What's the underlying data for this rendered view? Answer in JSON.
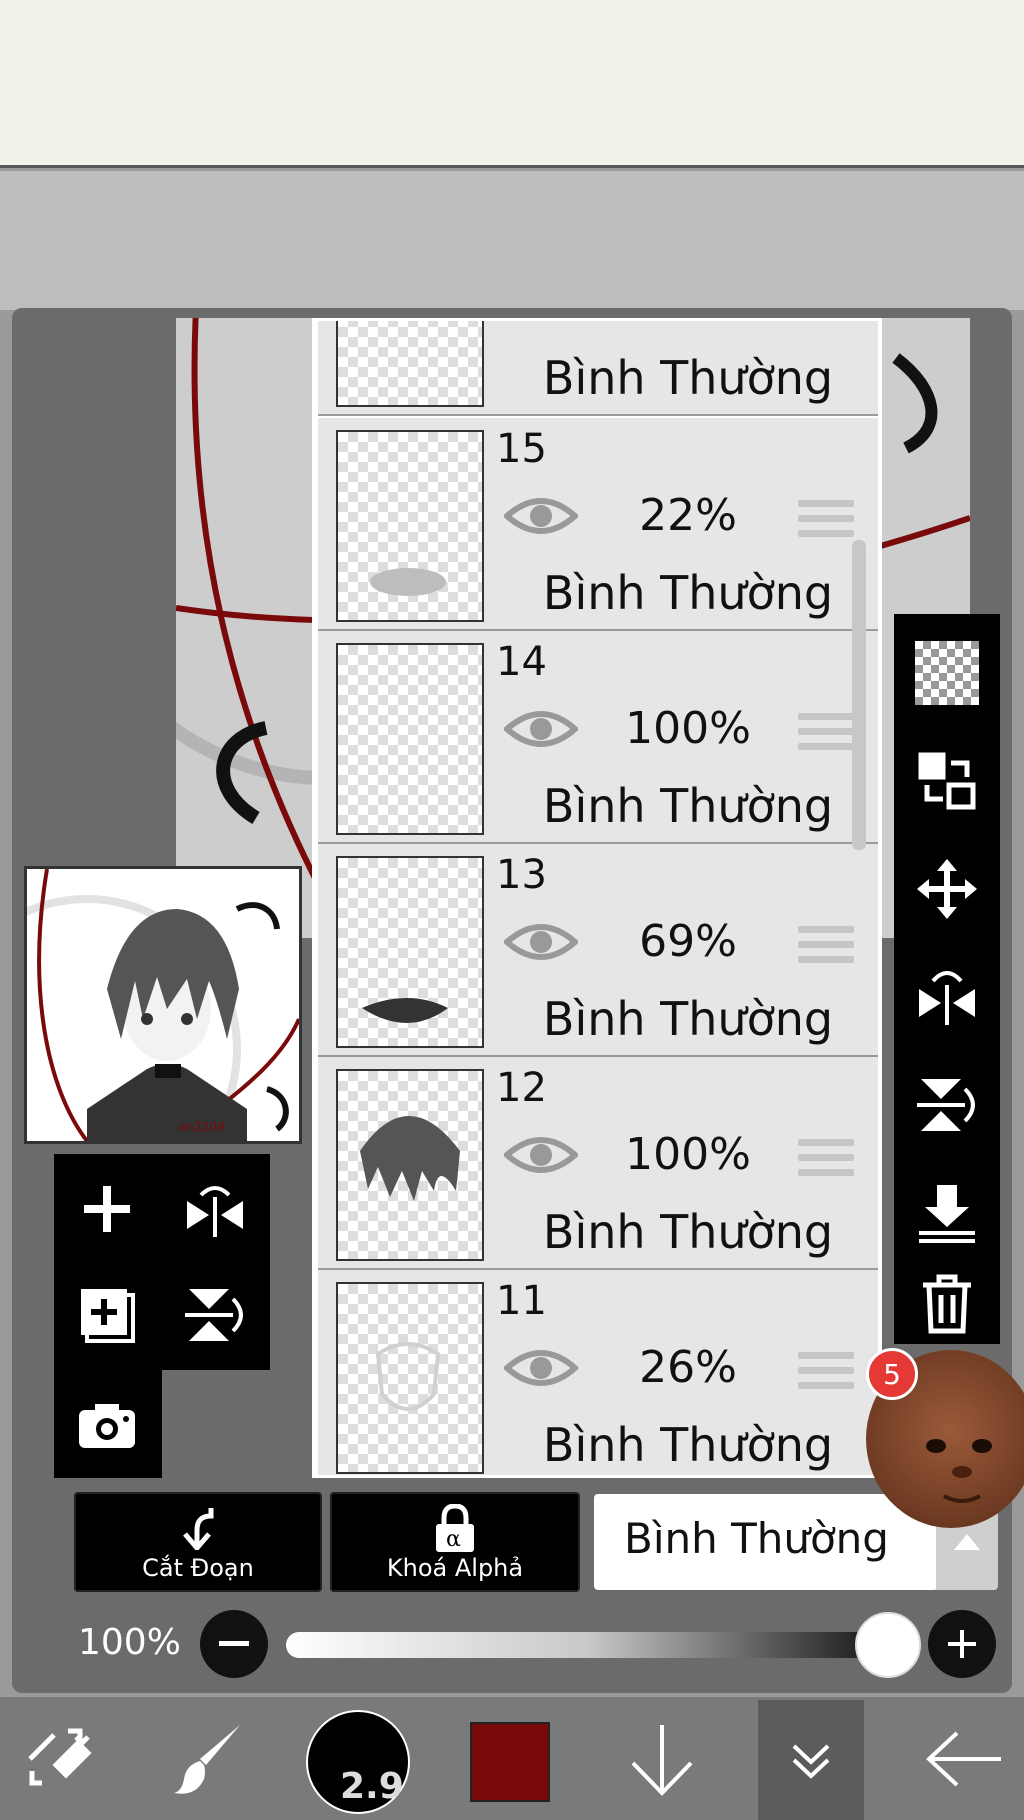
{
  "layers": [
    {
      "number": "",
      "opacity": "",
      "mode": "Bình Thường"
    },
    {
      "number": "15",
      "opacity": "22%",
      "mode": "Bình Thường"
    },
    {
      "number": "14",
      "opacity": "100%",
      "mode": "Bình Thường"
    },
    {
      "number": "13",
      "opacity": "69%",
      "mode": "Bình Thường"
    },
    {
      "number": "12",
      "opacity": "100%",
      "mode": "Bình Thường"
    },
    {
      "number": "11",
      "opacity": "26%",
      "mode": "Bình Thường"
    }
  ],
  "actions": {
    "clipping_label": "Cắt Đoạn",
    "alpha_lock_label": "Khoá Alphả",
    "blend_mode": "Bình Thường"
  },
  "opacity": {
    "label": "100%",
    "value": 1.0
  },
  "brush": {
    "size": "2.9",
    "color": "#7a0a0a"
  },
  "preview": {
    "signature": "an2209"
  },
  "notification": {
    "count": "5"
  },
  "right_toolbar_icons": [
    "transparency-icon",
    "swap-layer-icon",
    "move-icon",
    "flip-horizontal-icon",
    "flip-vertical-icon",
    "merge-down-icon",
    "trash-icon"
  ],
  "left_toolbar_icons": [
    "add-layer-icon",
    "flip-horizontal-icon",
    "add-copy-layer-icon",
    "flip-vertical-icon",
    "camera-icon"
  ],
  "bottom_nav_icons": [
    "tool-switch-icon",
    "brush-icon",
    "brush-size",
    "color-swatch",
    "arrow-down-icon",
    "layers-collapse-icon",
    "back-arrow-icon"
  ]
}
